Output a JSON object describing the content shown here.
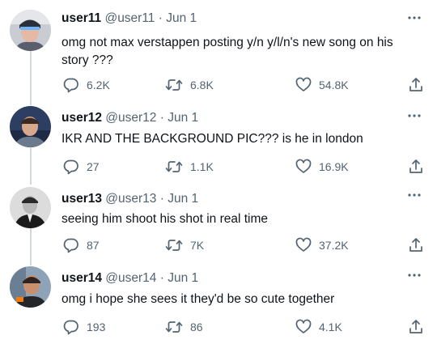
{
  "tweets": [
    {
      "name": "user11",
      "handle": "@user11",
      "separator": "·",
      "date": "Jun 1",
      "text_lines": [
        "omg not max verstappen posting y/n y/l/n's new song on his",
        "story ???"
      ],
      "replies": "6.2K",
      "retweets": "6.8K",
      "likes": "54.8K"
    },
    {
      "name": "user12",
      "handle": "@user12",
      "separator": "·",
      "date": "Jun 1",
      "text_lines": [
        "IKR AND THE BACKGROUND PIC??? is he in london"
      ],
      "replies": "27",
      "retweets": "1.1K",
      "likes": "16.9K"
    },
    {
      "name": "user13",
      "handle": "@user13",
      "separator": "·",
      "date": "Jun 1",
      "text_lines": [
        "seeing him shoot his shot in real time"
      ],
      "replies": "87",
      "retweets": "7K",
      "likes": "37.2K"
    },
    {
      "name": "user14",
      "handle": "@user14",
      "separator": "·",
      "date": "Jun 1",
      "text_lines": [
        "omg i hope she sees it they'd be so cute together"
      ],
      "replies": "193",
      "retweets": "86",
      "likes": "4.1K"
    }
  ],
  "colors": {
    "text_primary": "#0f1419",
    "text_secondary": "#536471",
    "thread_line": "#cfd9de"
  },
  "icons": [
    "reply-icon",
    "retweet-icon",
    "like-icon",
    "share-icon",
    "more-icon"
  ]
}
